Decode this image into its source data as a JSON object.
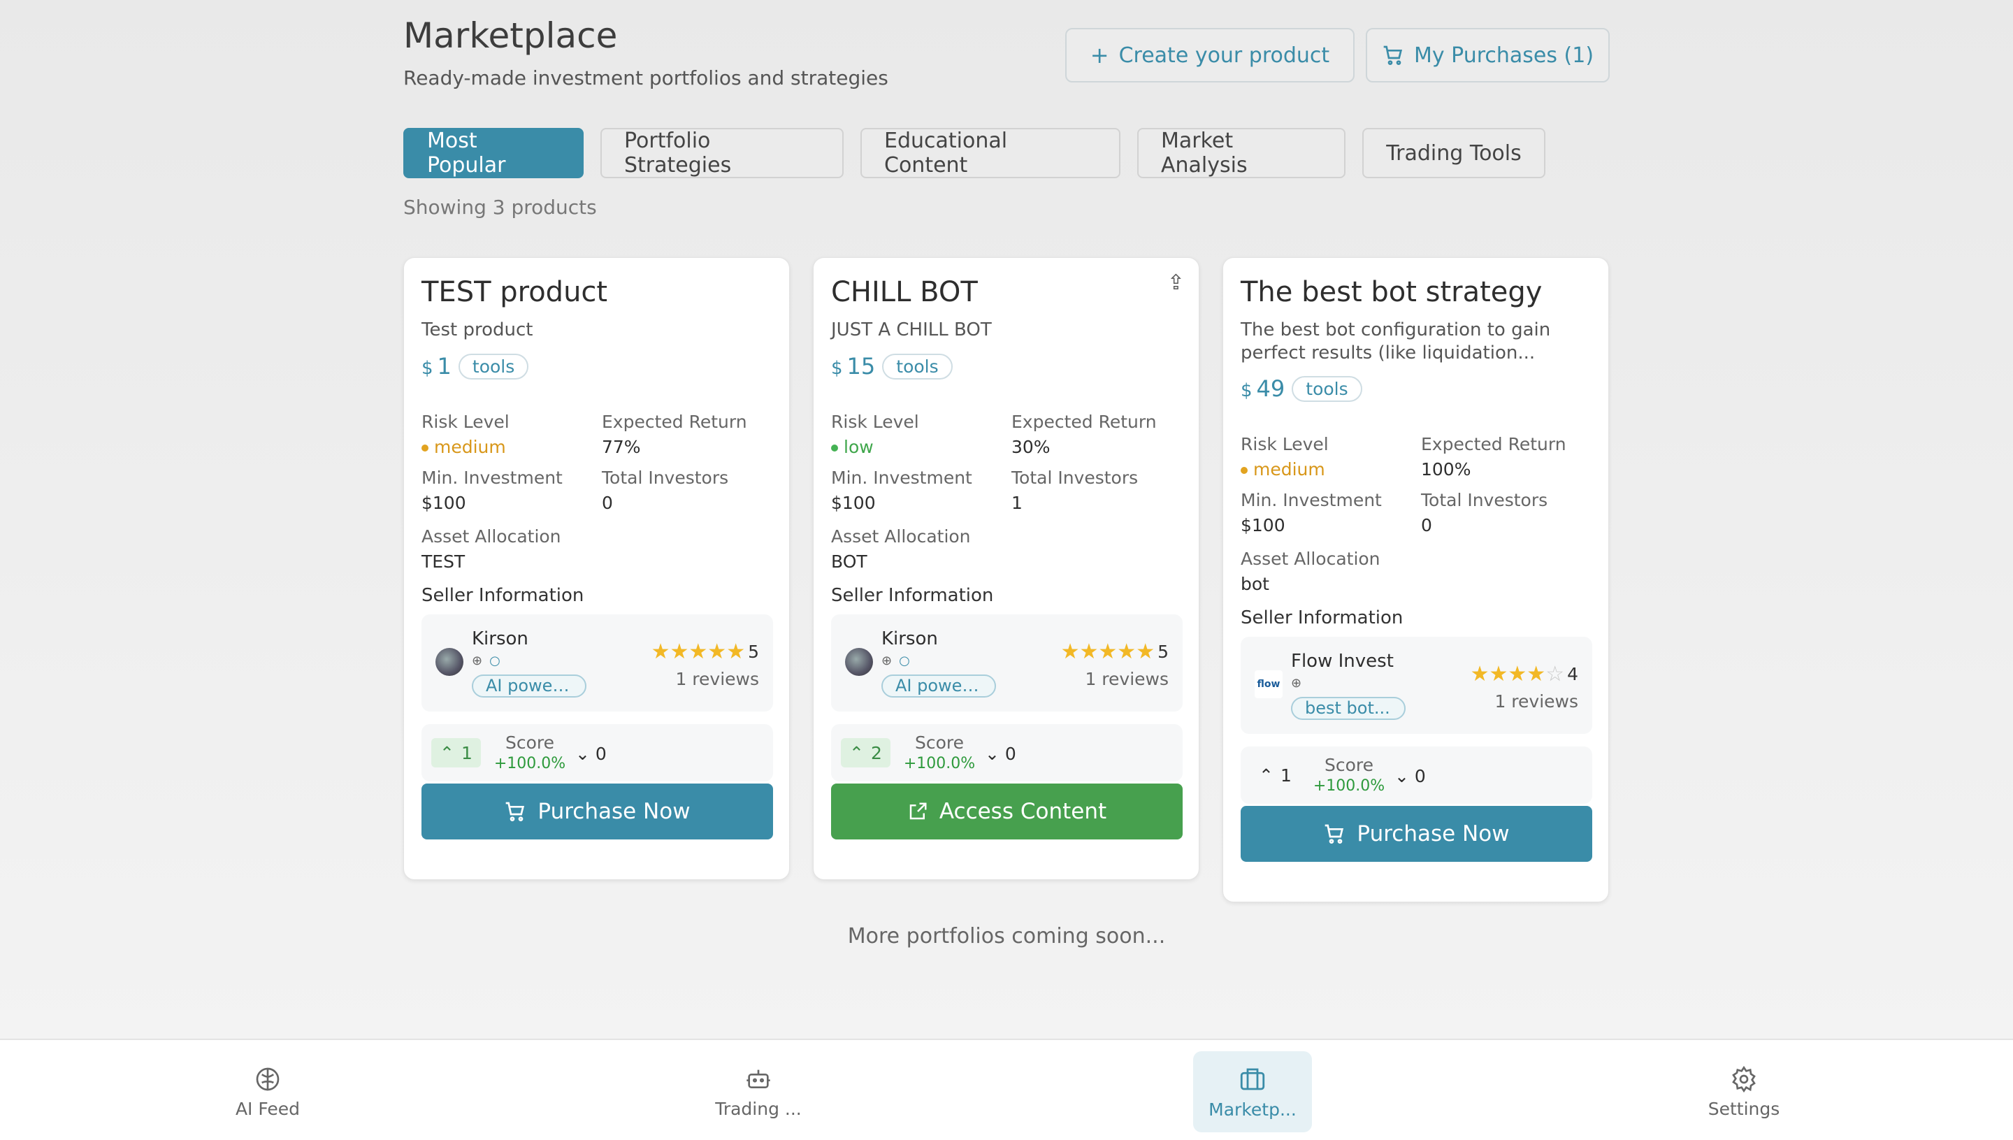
{
  "header": {
    "title": "Marketplace",
    "subtitle": "Ready-made investment portfolios and strategies",
    "create_label": "Create your product",
    "purchases_label": "My Purchases (1)"
  },
  "tabs": [
    {
      "label": "Most Popular",
      "active": true
    },
    {
      "label": "Portfolio Strategies",
      "active": false
    },
    {
      "label": "Educational Content",
      "active": false
    },
    {
      "label": "Market Analysis",
      "active": false
    },
    {
      "label": "Trading Tools",
      "active": false
    }
  ],
  "showing_text": "Showing 3 products",
  "labels": {
    "risk": "Risk Level",
    "return": "Expected Return",
    "min_inv": "Min. Investment",
    "investors": "Total Investors",
    "allocation": "Asset Allocation",
    "seller": "Seller Information",
    "score": "Score"
  },
  "products": [
    {
      "title": "TEST product",
      "description": "Test product",
      "currency": "$",
      "price": "1",
      "category": "tools",
      "risk": "medium",
      "expected_return": "77%",
      "min_investment": "$100",
      "total_investors": "0",
      "allocation": "TEST",
      "seller_name": "Kirson",
      "seller_tag": "AI power...",
      "rating": 5,
      "rating_text": "5",
      "reviews": "1 reviews",
      "upvotes": "1",
      "score": "+100.0%",
      "downvotes": "0",
      "cta": "Purchase Now",
      "cta_style": "blue"
    },
    {
      "title": "CHILL BOT",
      "description": "JUST A CHILL BOT",
      "currency": "$",
      "price": "15",
      "category": "tools",
      "risk": "low",
      "expected_return": "30%",
      "min_investment": "$100",
      "total_investors": "1",
      "allocation": "BOT",
      "seller_name": "Kirson",
      "seller_tag": "AI power...",
      "rating": 5,
      "rating_text": "5",
      "reviews": "1 reviews",
      "upvotes": "2",
      "score": "+100.0%",
      "downvotes": "0",
      "cta": "Access Content",
      "cta_style": "green"
    },
    {
      "title": "The best bot strategy",
      "description": "The best bot configuration to gain perfect results (like liquidation...",
      "currency": "$",
      "price": "49",
      "category": "tools",
      "risk": "medium",
      "expected_return": "100%",
      "min_investment": "$100",
      "total_investors": "0",
      "allocation": "bot",
      "seller_name": "Flow Invest",
      "seller_logo_text": "flow",
      "seller_tag": "best bot...",
      "rating": 4,
      "rating_text": "4",
      "reviews": "1 reviews",
      "upvotes": "1",
      "score": "+100.0%",
      "downvotes": "0",
      "cta": "Purchase Now",
      "cta_style": "blue"
    }
  ],
  "coming_soon": "More portfolios coming soon...",
  "nav": [
    {
      "label": "AI Feed",
      "icon": "brain-icon",
      "active": false
    },
    {
      "label": "Trading ...",
      "icon": "bot-icon",
      "active": false
    },
    {
      "label": "Marketp...",
      "icon": "briefcase-icon",
      "active": true
    },
    {
      "label": "Settings",
      "icon": "gear-icon",
      "active": false
    }
  ],
  "colors": {
    "accent": "#3a8ca8",
    "success": "#47a04e",
    "warning": "#e2a320"
  }
}
